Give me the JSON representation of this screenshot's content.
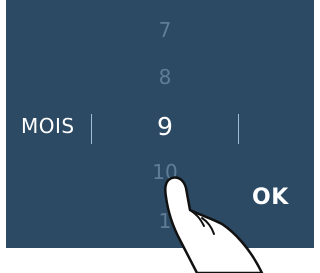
{
  "picker": {
    "label": "MOIS",
    "values": [
      "7",
      "8",
      "9",
      "10",
      "1"
    ],
    "selected": "9"
  },
  "actions": {
    "ok_label": "OK"
  },
  "colors": {
    "panel": "#2d4a64",
    "divider": "#9fbdd8",
    "inactive_number": "#5f7d98",
    "text": "#ffffff"
  },
  "icons": {
    "hand": "pointing-hand-icon"
  }
}
